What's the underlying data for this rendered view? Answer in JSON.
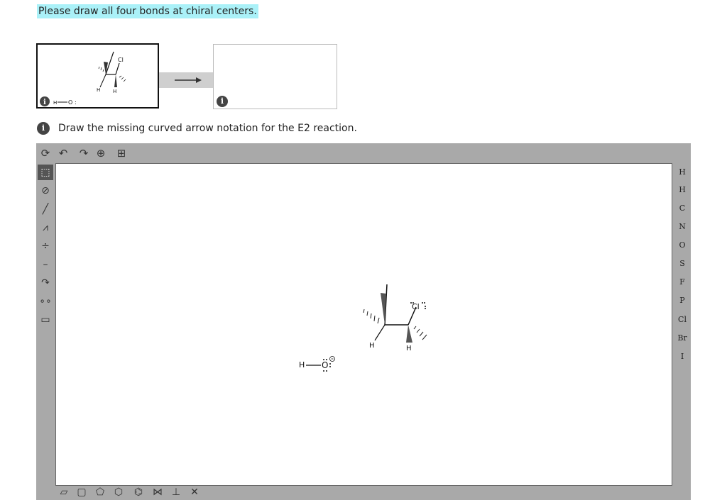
{
  "header": {
    "instruction": "Please draw all four bonds at chiral centers."
  },
  "prompt": {
    "info_glyph": "i",
    "text": "Draw the missing curved arrow notation for the E2 reaction."
  },
  "molecule": {
    "h_label": "H",
    "o_label": "O",
    "cl_label": "Cl",
    "h_left": "H",
    "h_right": "H"
  },
  "left_toolbar": [
    "select-tool",
    "eraser-tool",
    "bond-tool",
    "chain-tool",
    "charge-tool",
    "single-bond-tool",
    "curved-arrow-tool",
    "lone-pair-tool",
    "rectangle-tool"
  ],
  "top_toolbar": [
    "rotate-icon",
    "undo-icon",
    "redo-icon",
    "zoom-icon",
    "template-icon"
  ],
  "elements": [
    "H",
    "C",
    "N",
    "O",
    "S",
    "F",
    "P",
    "Cl",
    "Br",
    "I"
  ],
  "periodic_label": "H"
}
